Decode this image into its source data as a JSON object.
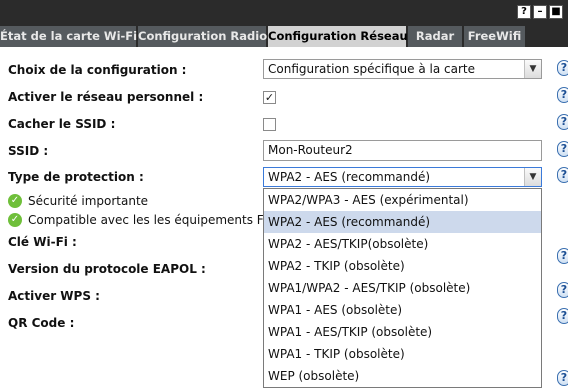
{
  "window_controls": {
    "help": "?",
    "minimize": "–",
    "close": "■"
  },
  "tabs": [
    {
      "label": "État de la carte Wi-Fi"
    },
    {
      "label": "Configuration Radio"
    },
    {
      "label": "Configuration Réseau",
      "active": true
    },
    {
      "label": "Radar"
    },
    {
      "label": "FreeWifi"
    }
  ],
  "help_icon": "?",
  "form": {
    "config_choice_label": "Choix de la configuration :",
    "config_choice_value": "Configuration spécifique à la carte",
    "activate_network_label": "Activer le réseau personnel :",
    "activate_network_checked": true,
    "hide_ssid_label": "Cacher le SSID :",
    "hide_ssid_checked": false,
    "ssid_label": "SSID :",
    "ssid_value": "Mon-Routeur2",
    "protection_label": "Type de protection :",
    "protection_value": "WPA2 - AES (recommandé)",
    "security_note": "Sécurité importante",
    "compat_note": "Compatible avec les les équipements Freeb",
    "wifi_key_label": "Clé Wi-Fi :",
    "eapol_label": "Version du protocole EAPOL :",
    "wps_label": "Activer WPS :",
    "qr_label": "QR Code :"
  },
  "dropdown_options": [
    "WPA2/WPA3 - AES (expérimental)",
    "WPA2 - AES (recommandé)",
    "WPA2 - AES/TKIP(obsolète)",
    "WPA2 - TKIP (obsolète)",
    "WPA1/WPA2 - AES/TKIP (obsolète)",
    "WPA1 - AES (obsolète)",
    "WPA1 - AES/TKIP (obsolète)",
    "WPA1 - TKIP (obsolète)",
    "WEP (obsolète)"
  ],
  "dropdown_selected_index": 1,
  "colors": {
    "tab_bg": "#555a5e",
    "tab_active_bg": "#d2d2d2",
    "selected_option": "#cdd9ec",
    "ok_green": "#6fbf3a"
  }
}
